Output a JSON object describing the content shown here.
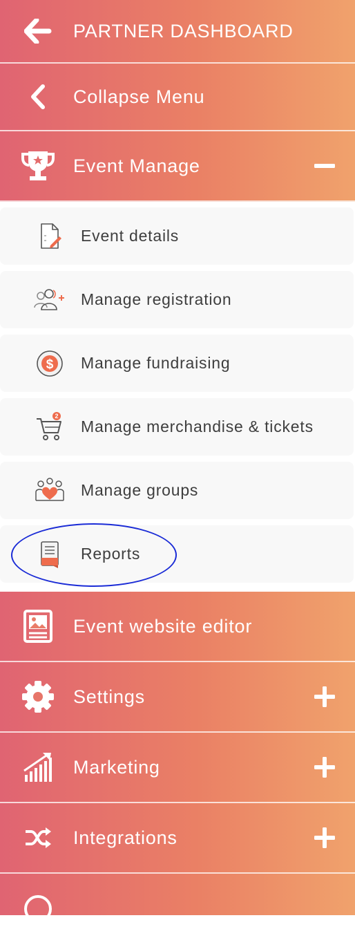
{
  "colors": {
    "gradient_start": "#e06472",
    "gradient_mid": "#ea8065",
    "gradient_end": "#f0a26c",
    "accent_orange": "#ee6c4d",
    "highlight_ring": "#1a2bd6"
  },
  "header": {
    "back_icon": "arrow-left-icon",
    "title": "PARTNER DASHBOARD"
  },
  "collapse": {
    "icon": "chevron-left-icon",
    "label": "Collapse Menu"
  },
  "event_manage": {
    "icon": "trophy-icon",
    "label": "Event Manage",
    "toggle": "minus-icon",
    "expanded": true,
    "items": [
      {
        "label": "Event details",
        "icon": "document-edit-icon"
      },
      {
        "label": "Manage registration",
        "icon": "add-users-icon"
      },
      {
        "label": "Manage fundraising",
        "icon": "dollar-coin-icon"
      },
      {
        "label": "Manage merchandise & tickets",
        "icon": "shopping-cart-icon",
        "badge": "2"
      },
      {
        "label": "Manage groups",
        "icon": "group-heart-icon"
      },
      {
        "label": "Reports",
        "icon": "report-icon",
        "highlighted": true
      }
    ]
  },
  "menu": [
    {
      "label": "Event website editor",
      "icon": "website-image-icon"
    },
    {
      "label": "Settings",
      "icon": "gear-icon",
      "toggle": "plus-icon"
    },
    {
      "label": "Marketing",
      "icon": "growth-chart-icon",
      "toggle": "plus-icon"
    },
    {
      "label": "Integrations",
      "icon": "shuffle-icon",
      "toggle": "plus-icon"
    }
  ]
}
